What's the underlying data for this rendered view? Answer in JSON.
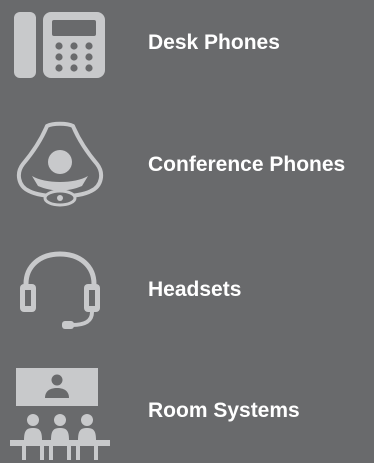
{
  "colors": {
    "background": "#696a6c",
    "icon": "#c8c9cb",
    "text": "#ffffff"
  },
  "menu": {
    "items": [
      {
        "label": "Desk Phones",
        "icon": "desk-phone-icon"
      },
      {
        "label": "Conference Phones",
        "icon": "conference-phone-icon"
      },
      {
        "label": "Headsets",
        "icon": "headset-icon"
      },
      {
        "label": "Room Systems",
        "icon": "room-system-icon"
      }
    ]
  }
}
